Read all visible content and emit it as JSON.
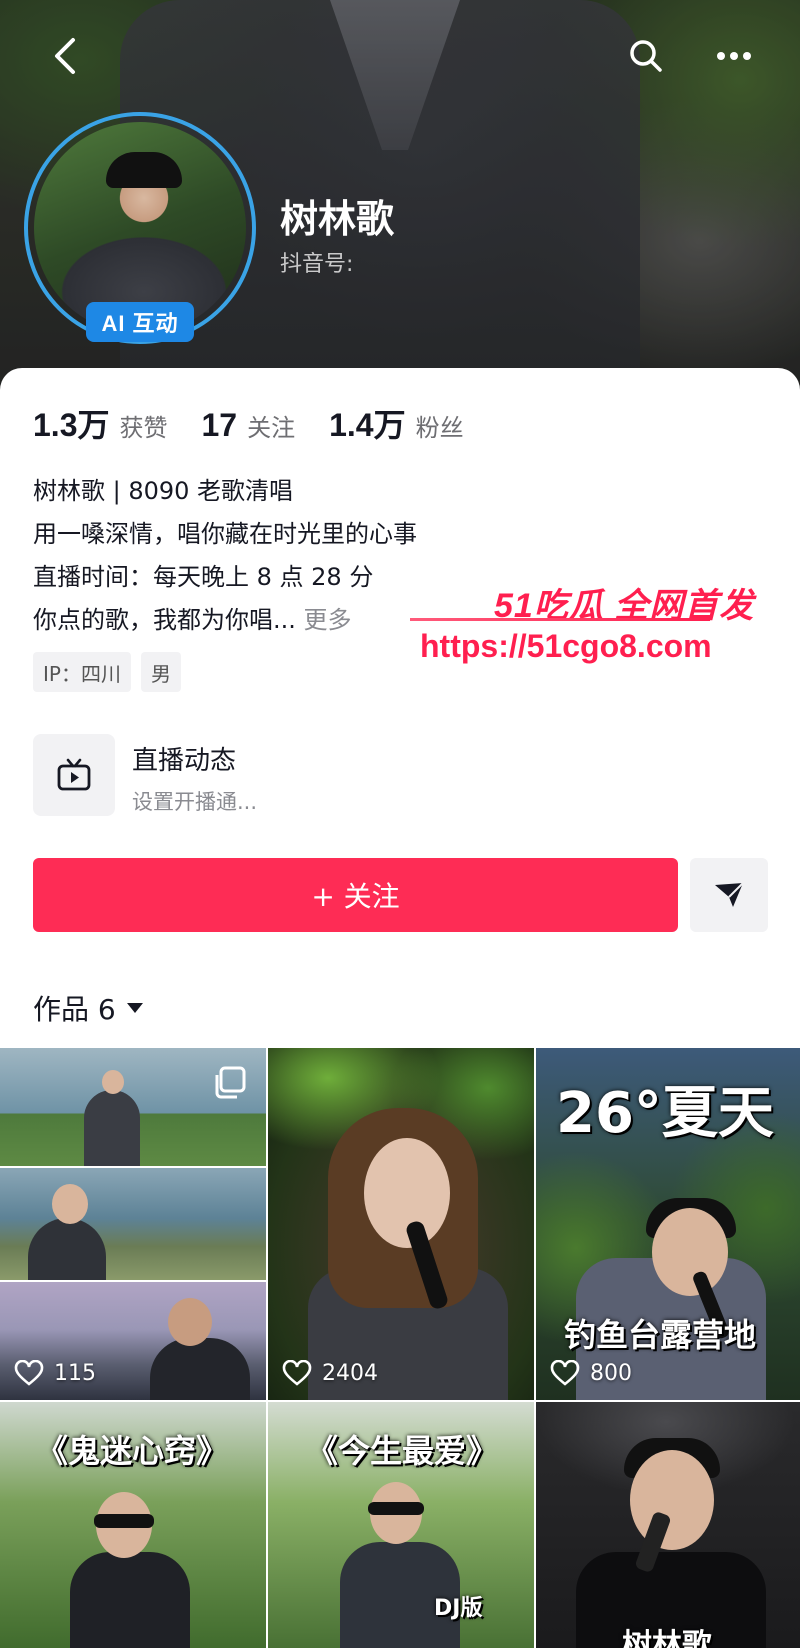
{
  "profile": {
    "name": "树林歌",
    "douyin_id_label": "抖音号:",
    "ai_badge": "AI 互动"
  },
  "stats": [
    {
      "value": "1.3万",
      "label": "获赞"
    },
    {
      "value": "17",
      "label": "关注"
    },
    {
      "value": "1.4万",
      "label": "粉丝"
    }
  ],
  "bio": {
    "line1": "树林歌 | 8090 老歌清唱",
    "line2": "用一嗓深情，唱你藏在时光里的心事",
    "line3": "直播时间：每天晚上 8 点 28 分",
    "line4": "你点的歌，我都为你唱...",
    "more": "更多"
  },
  "tags": [
    "IP：四川",
    "男"
  ],
  "live": {
    "title": "直播动态",
    "subtitle": "设置开播通..."
  },
  "actions": {
    "follow": "+ 关注"
  },
  "works": {
    "label": "作品 6"
  },
  "watermark": {
    "line1": "51吃瓜 全网首发",
    "line2": "https://51cgo8.com"
  },
  "videos": [
    {
      "likes": "115",
      "overlay": ""
    },
    {
      "likes": "2404",
      "overlay": ""
    },
    {
      "likes": "800",
      "overlay_top": "26°夏天",
      "overlay_bottom": "钓鱼台露营地"
    },
    {
      "overlay_top": "《鬼迷心窍》"
    },
    {
      "overlay_top": "《今生最爱》",
      "overlay_bottom": "DJ版"
    },
    {
      "overlay_bottom": "树林歌"
    }
  ],
  "colors": {
    "accent": "#fe2c55",
    "ai_badge": "#1e88e5",
    "avatar_ring": "#3aa3e6"
  },
  "icons": [
    "back-icon",
    "search-icon",
    "more-icon",
    "tv-icon",
    "send-icon",
    "heart-icon",
    "multi-image-icon",
    "dropdown-triangle-icon"
  ]
}
